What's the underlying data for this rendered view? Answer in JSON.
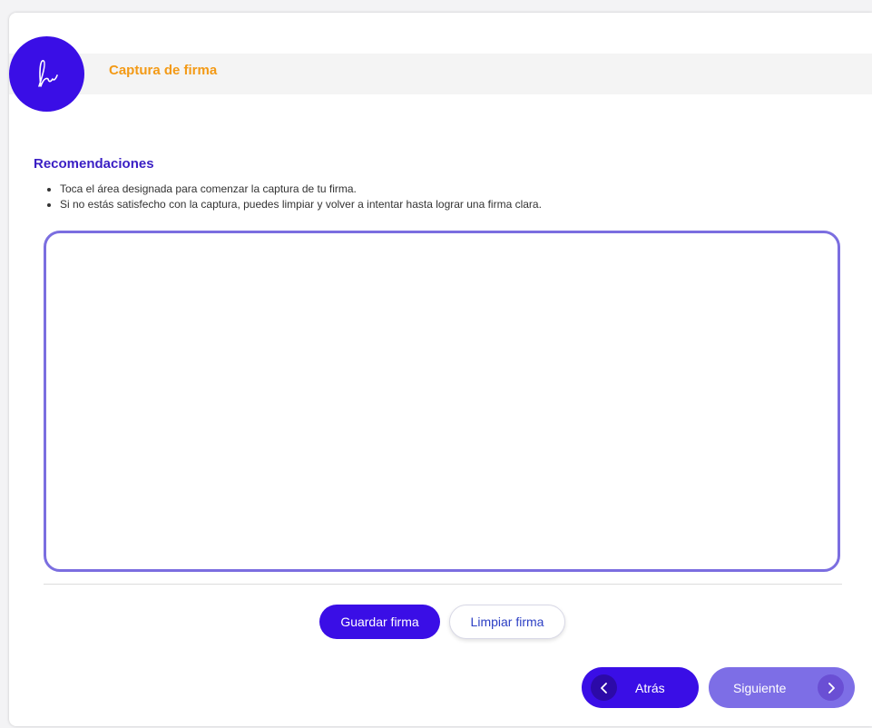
{
  "header": {
    "title": "Captura de firma",
    "logo_icon": "signature-logo-icon"
  },
  "recommendations": {
    "title": "Recomendaciones",
    "items": [
      "Toca el área designada para comenzar la captura de tu firma.",
      "Si no estás satisfecho con la captura, puedes limpiar y volver a intentar hasta lograr una firma clara."
    ]
  },
  "signature_pad": {
    "value": ""
  },
  "actions": {
    "save_label": "Guardar firma",
    "clear_label": "Limpiar firma"
  },
  "navigation": {
    "back_label": "Atrás",
    "next_label": "Siguiente",
    "back_icon": "chevron-left-icon",
    "next_icon": "chevron-right-icon"
  },
  "colors": {
    "primary": "#3a0ee6",
    "accent_title": "#f39a16",
    "pad_border": "#7b6ee0",
    "next_button": "#7d6ee6"
  }
}
